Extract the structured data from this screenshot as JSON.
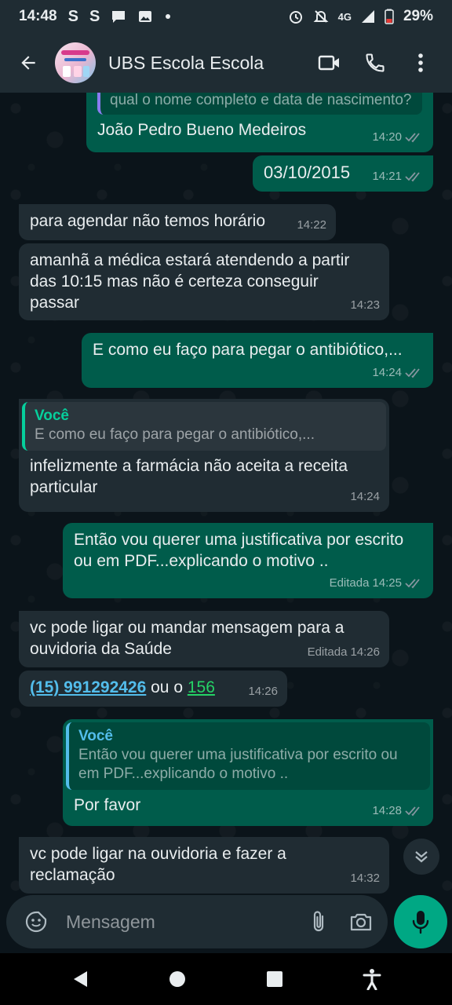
{
  "status_bar": {
    "time": "14:48",
    "left_glyphs": [
      "S",
      "S"
    ],
    "network": "4G",
    "battery": "29%"
  },
  "header": {
    "title": "UBS Escola Escola"
  },
  "messages": [
    {
      "direction": "out",
      "quote_text": "qual o nome completo e data de nascimento?",
      "text": "João Pedro Bueno Medeiros",
      "time": "14:20"
    },
    {
      "direction": "out",
      "text": "03/10/2015",
      "time": "14:21"
    },
    {
      "direction": "in",
      "text": "para agendar não temos horário",
      "time": "14:22"
    },
    {
      "direction": "in",
      "text": "amanhã a médica estará atendendo a partir das 10:15 mas não é certeza conseguir passar",
      "time": "14:23"
    },
    {
      "direction": "out",
      "text": "E como eu faço para pegar o antibiótico,...",
      "time": "14:24"
    },
    {
      "direction": "in",
      "quote_author": "Você",
      "quote_text": "E como eu faço para pegar o antibiótico,...",
      "text": "infelizmente a farmácia não aceita a receita particular",
      "time": "14:24"
    },
    {
      "direction": "out",
      "text": "Então vou querer uma justificativa por escrito ou em PDF...explicando o motivo ..",
      "edited": "Editada",
      "time": "14:25"
    },
    {
      "direction": "in",
      "text": "vc pode ligar ou mandar mensagem para a ouvidoria da Saúde",
      "edited": "Editada",
      "time": "14:26"
    },
    {
      "direction": "in",
      "phone": "(15) 991292426",
      "connector": " ou o ",
      "number": "156",
      "time": "14:26"
    },
    {
      "direction": "out",
      "quote_author": "Você",
      "quote_text": "Então vou querer uma justificativa por escrito ou em PDF...explicando o motivo ..",
      "text": "Por favor",
      "time": "14:28"
    },
    {
      "direction": "in",
      "text": "vc pode ligar na ouvidoria e fazer a reclamação",
      "time": "14:32"
    }
  ],
  "composer": {
    "placeholder": "Mensagem"
  },
  "colors": {
    "outgoing_bubble": "#005c4b",
    "incoming_bubble": "#202c33",
    "header_bg": "#1f2c33",
    "accent": "#00a884",
    "read_ticks": "#8696a0"
  },
  "icons": [
    "back-arrow-icon",
    "video-call-icon",
    "phone-icon",
    "more-vert-icon",
    "sticker-icon",
    "attach-icon",
    "camera-icon",
    "mic-icon",
    "scroll-down-icon",
    "nav-back-icon",
    "nav-home-icon",
    "nav-recents-icon",
    "accessibility-icon"
  ]
}
